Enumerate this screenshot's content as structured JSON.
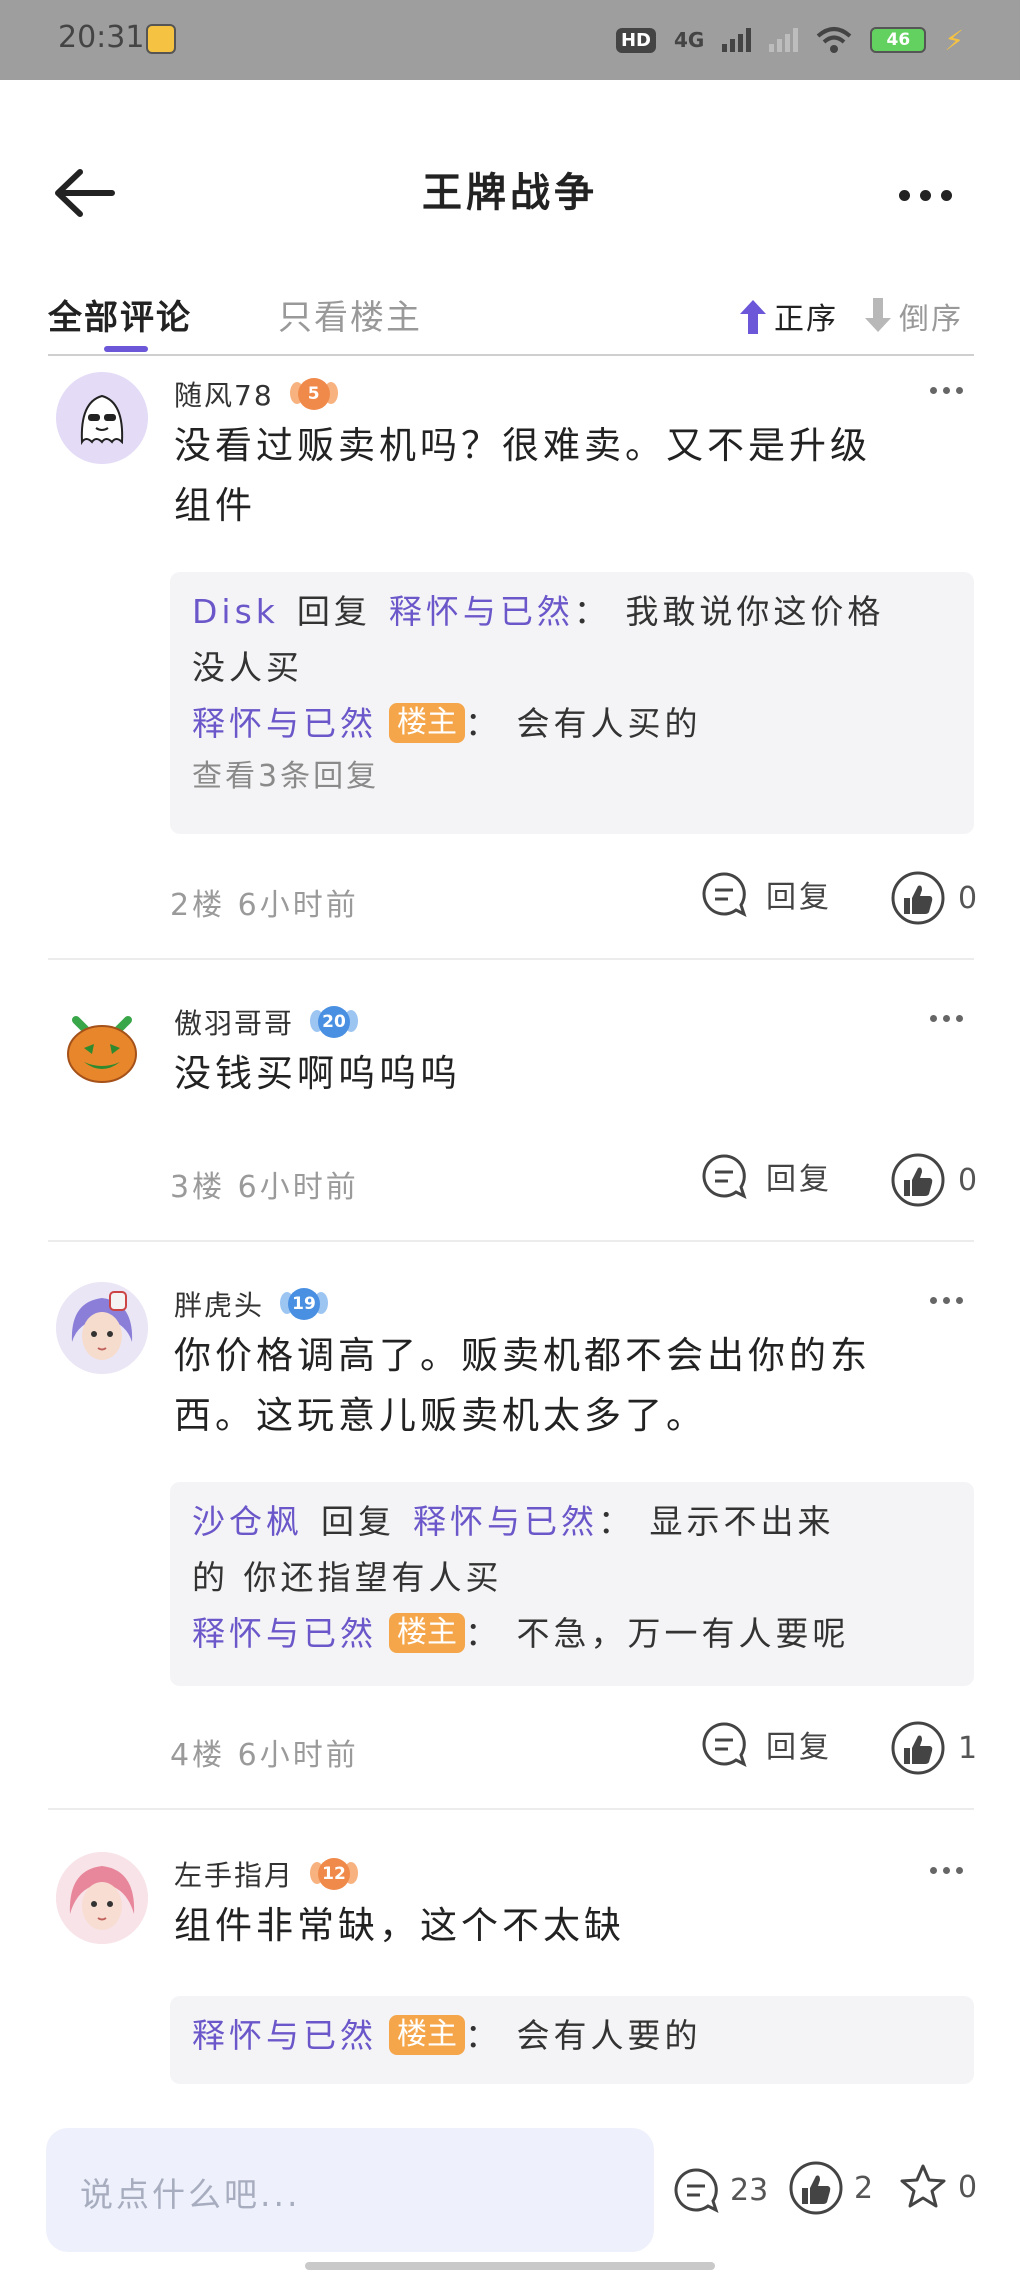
{
  "status_bar": {
    "time": "20:31",
    "hd_label": "HD",
    "network_label": "4G",
    "battery_level": "46"
  },
  "header": {
    "title": "王牌战争"
  },
  "tabs": {
    "all_label": "全部评论",
    "owner_only_label": "只看楼主",
    "sort_asc_label": "正序",
    "sort_desc_label": "倒序"
  },
  "comments": [
    {
      "author": "随风78",
      "level": "5",
      "badge_color": "#f08a4b",
      "text_lines": [
        "没看过贩卖机吗？很难卖。又不是升级",
        "组件"
      ],
      "replies": [
        {
          "user": "Disk",
          "action": "回复",
          "target": "释怀与已然",
          "text": "：  我敢说你这价格",
          "text2": "没人买",
          "owner": ""
        },
        {
          "user": "释怀与已然",
          "action": "",
          "target": "",
          "text": "：  会有人买的",
          "text2": "",
          "owner": "楼主"
        }
      ],
      "view_replies": "查看3条回复",
      "floor": "2楼  6小时前",
      "reply_label": "回复",
      "likes": "0"
    },
    {
      "author": "傲羽哥哥",
      "level": "20",
      "badge_color": "#4a90e2",
      "text_lines": [
        "没钱买啊呜呜呜"
      ],
      "replies": [],
      "view_replies": "",
      "floor": "3楼  6小时前",
      "reply_label": "回复",
      "likes": "0"
    },
    {
      "author": "胖虎头",
      "level": "19",
      "badge_color": "#4a90e2",
      "text_lines": [
        "你价格调高了。贩卖机都不会出你的东",
        "西。这玩意儿贩卖机太多了。"
      ],
      "replies": [
        {
          "user": "沙仓枫",
          "action": "回复",
          "target": "释怀与已然",
          "text": "：  显示不出来",
          "text2": "的  你还指望有人买",
          "owner": ""
        },
        {
          "user": "释怀与已然",
          "action": "",
          "target": "",
          "text": "：  不急，万一有人要呢",
          "text2": "",
          "owner": "楼主"
        }
      ],
      "view_replies": "",
      "floor": "4楼  6小时前",
      "reply_label": "回复",
      "likes": "1"
    },
    {
      "author": "左手指月",
      "level": "12",
      "badge_color": "#f08a4b",
      "text_lines": [
        "组件非常缺，这个不太缺"
      ],
      "replies": [
        {
          "user": "释怀与已然",
          "action": "",
          "target": "",
          "text": "：  会有人要的",
          "text2": "",
          "owner": "楼主"
        }
      ],
      "view_replies": "",
      "floor": "",
      "reply_label": "",
      "likes": ""
    }
  ],
  "bottom_bar": {
    "input_placeholder": "说点什么吧...",
    "comment_count": "23",
    "like_count": "2",
    "favorite_count": "0"
  },
  "colors": {
    "accent": "#6b57d8",
    "username_purple": "#6b57c9",
    "owner_tag": "#f5a64a"
  }
}
